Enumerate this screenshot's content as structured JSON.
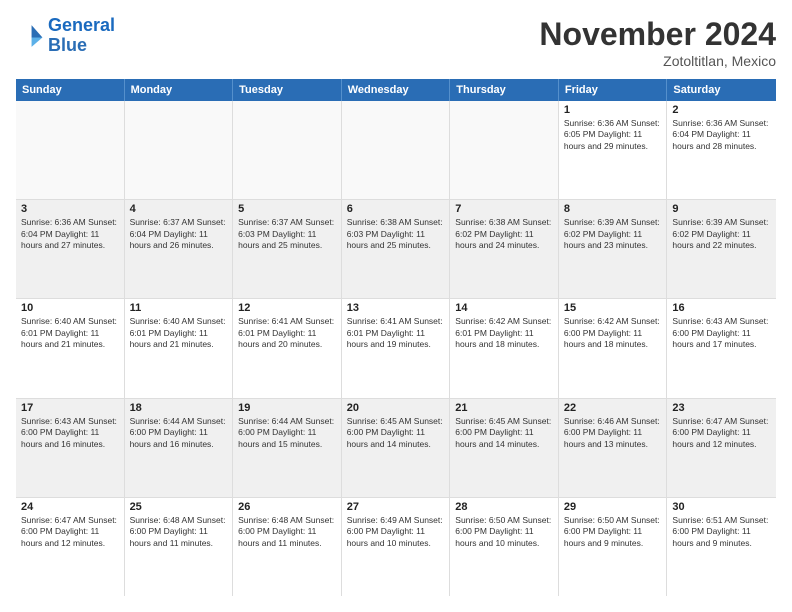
{
  "logo": {
    "line1": "General",
    "line2": "Blue"
  },
  "title": "November 2024",
  "subtitle": "Zotoltitlan, Mexico",
  "days": [
    "Sunday",
    "Monday",
    "Tuesday",
    "Wednesday",
    "Thursday",
    "Friday",
    "Saturday"
  ],
  "weeks": [
    [
      {
        "day": "",
        "info": "",
        "empty": true
      },
      {
        "day": "",
        "info": "",
        "empty": true
      },
      {
        "day": "",
        "info": "",
        "empty": true
      },
      {
        "day": "",
        "info": "",
        "empty": true
      },
      {
        "day": "",
        "info": "",
        "empty": true
      },
      {
        "day": "1",
        "info": "Sunrise: 6:36 AM\nSunset: 6:05 PM\nDaylight: 11 hours\nand 29 minutes."
      },
      {
        "day": "2",
        "info": "Sunrise: 6:36 AM\nSunset: 6:04 PM\nDaylight: 11 hours\nand 28 minutes."
      }
    ],
    [
      {
        "day": "3",
        "info": "Sunrise: 6:36 AM\nSunset: 6:04 PM\nDaylight: 11 hours\nand 27 minutes."
      },
      {
        "day": "4",
        "info": "Sunrise: 6:37 AM\nSunset: 6:04 PM\nDaylight: 11 hours\nand 26 minutes."
      },
      {
        "day": "5",
        "info": "Sunrise: 6:37 AM\nSunset: 6:03 PM\nDaylight: 11 hours\nand 25 minutes."
      },
      {
        "day": "6",
        "info": "Sunrise: 6:38 AM\nSunset: 6:03 PM\nDaylight: 11 hours\nand 25 minutes."
      },
      {
        "day": "7",
        "info": "Sunrise: 6:38 AM\nSunset: 6:02 PM\nDaylight: 11 hours\nand 24 minutes."
      },
      {
        "day": "8",
        "info": "Sunrise: 6:39 AM\nSunset: 6:02 PM\nDaylight: 11 hours\nand 23 minutes."
      },
      {
        "day": "9",
        "info": "Sunrise: 6:39 AM\nSunset: 6:02 PM\nDaylight: 11 hours\nand 22 minutes."
      }
    ],
    [
      {
        "day": "10",
        "info": "Sunrise: 6:40 AM\nSunset: 6:01 PM\nDaylight: 11 hours\nand 21 minutes."
      },
      {
        "day": "11",
        "info": "Sunrise: 6:40 AM\nSunset: 6:01 PM\nDaylight: 11 hours\nand 21 minutes."
      },
      {
        "day": "12",
        "info": "Sunrise: 6:41 AM\nSunset: 6:01 PM\nDaylight: 11 hours\nand 20 minutes."
      },
      {
        "day": "13",
        "info": "Sunrise: 6:41 AM\nSunset: 6:01 PM\nDaylight: 11 hours\nand 19 minutes."
      },
      {
        "day": "14",
        "info": "Sunrise: 6:42 AM\nSunset: 6:01 PM\nDaylight: 11 hours\nand 18 minutes."
      },
      {
        "day": "15",
        "info": "Sunrise: 6:42 AM\nSunset: 6:00 PM\nDaylight: 11 hours\nand 18 minutes."
      },
      {
        "day": "16",
        "info": "Sunrise: 6:43 AM\nSunset: 6:00 PM\nDaylight: 11 hours\nand 17 minutes."
      }
    ],
    [
      {
        "day": "17",
        "info": "Sunrise: 6:43 AM\nSunset: 6:00 PM\nDaylight: 11 hours\nand 16 minutes."
      },
      {
        "day": "18",
        "info": "Sunrise: 6:44 AM\nSunset: 6:00 PM\nDaylight: 11 hours\nand 16 minutes."
      },
      {
        "day": "19",
        "info": "Sunrise: 6:44 AM\nSunset: 6:00 PM\nDaylight: 11 hours\nand 15 minutes."
      },
      {
        "day": "20",
        "info": "Sunrise: 6:45 AM\nSunset: 6:00 PM\nDaylight: 11 hours\nand 14 minutes."
      },
      {
        "day": "21",
        "info": "Sunrise: 6:45 AM\nSunset: 6:00 PM\nDaylight: 11 hours\nand 14 minutes."
      },
      {
        "day": "22",
        "info": "Sunrise: 6:46 AM\nSunset: 6:00 PM\nDaylight: 11 hours\nand 13 minutes."
      },
      {
        "day": "23",
        "info": "Sunrise: 6:47 AM\nSunset: 6:00 PM\nDaylight: 11 hours\nand 12 minutes."
      }
    ],
    [
      {
        "day": "24",
        "info": "Sunrise: 6:47 AM\nSunset: 6:00 PM\nDaylight: 11 hours\nand 12 minutes."
      },
      {
        "day": "25",
        "info": "Sunrise: 6:48 AM\nSunset: 6:00 PM\nDaylight: 11 hours\nand 11 minutes."
      },
      {
        "day": "26",
        "info": "Sunrise: 6:48 AM\nSunset: 6:00 PM\nDaylight: 11 hours\nand 11 minutes."
      },
      {
        "day": "27",
        "info": "Sunrise: 6:49 AM\nSunset: 6:00 PM\nDaylight: 11 hours\nand 10 minutes."
      },
      {
        "day": "28",
        "info": "Sunrise: 6:50 AM\nSunset: 6:00 PM\nDaylight: 11 hours\nand 10 minutes."
      },
      {
        "day": "29",
        "info": "Sunrise: 6:50 AM\nSunset: 6:00 PM\nDaylight: 11 hours\nand 9 minutes."
      },
      {
        "day": "30",
        "info": "Sunrise: 6:51 AM\nSunset: 6:00 PM\nDaylight: 11 hours\nand 9 minutes."
      }
    ]
  ]
}
